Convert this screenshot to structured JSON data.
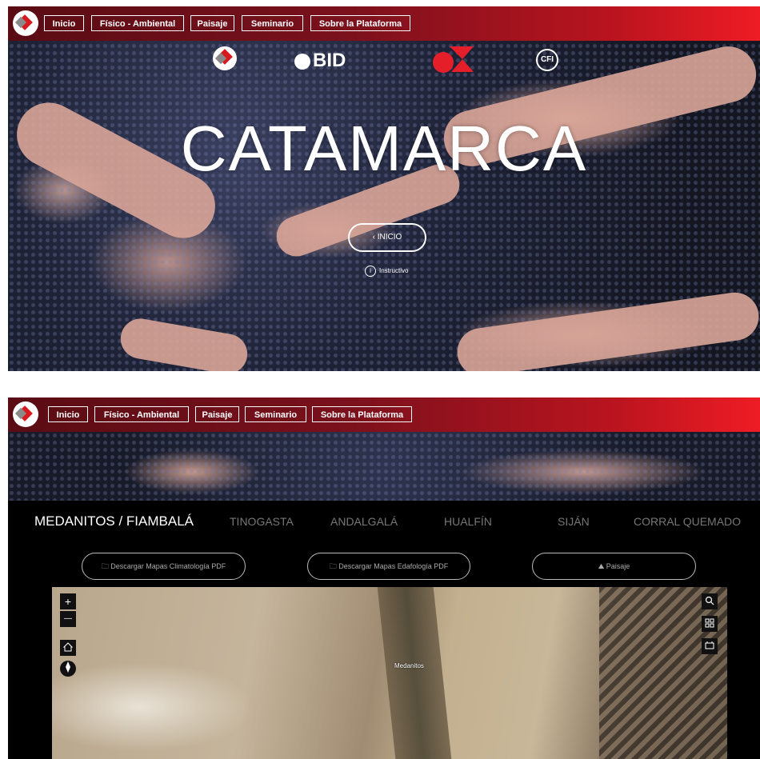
{
  "nav": {
    "items": [
      "Inicio",
      "Físico - Ambiental",
      "Paisaje",
      "Seminario",
      "Sobre la Plataforma"
    ]
  },
  "hero": {
    "sponsors": [
      "BID",
      "CFI"
    ],
    "title": "CATAMARCA",
    "inicio_button": "‹  INICIO",
    "instructions": "Instructivo"
  },
  "tabs": [
    "MEDANITOS / FIAMBALÁ",
    "TINOGASTA",
    "ANDALGALÁ",
    "HUALFÍN",
    "SIJÁN",
    "CORRAL QUEMADO"
  ],
  "actions": {
    "climatologia": "Descargar Mapas Climatología PDF",
    "edafologia": "Descargar Mapas Edafología PDF",
    "paisaje": "Paisaje"
  },
  "map": {
    "place_label": "Medanitos",
    "zoom_in": "+",
    "zoom_out": "—"
  },
  "icons": {
    "logo": "platform-logo-icon",
    "folder": "folder-icon",
    "paisaje": "landscape-icon",
    "home": "home-icon",
    "compass": "compass-icon",
    "search": "search-icon",
    "basemap": "basemap-gallery-icon",
    "layers": "layer-list-icon"
  },
  "colors": {
    "nav_start": "#5a0c14",
    "nav_end": "#ee1c25",
    "brand_red": "#d71920"
  }
}
